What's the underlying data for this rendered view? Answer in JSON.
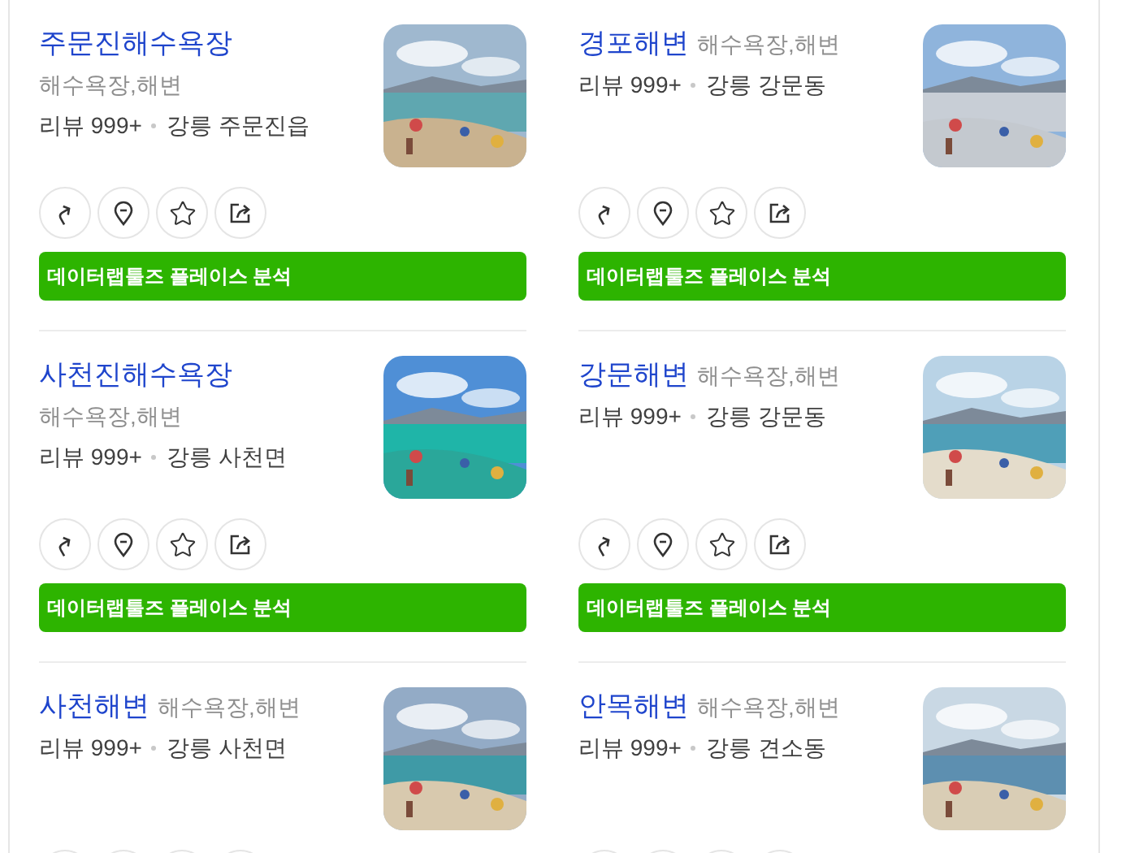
{
  "places": [
    {
      "name": "주문진해수욕장",
      "category": "해수욕장,해변",
      "reviews": "리뷰 999+",
      "location": "강릉 주문진읍",
      "analysis_button": "데이터랩툴즈 플레이스 분석"
    },
    {
      "name": "경포해변",
      "category": "해수욕장,해변",
      "reviews": "리뷰 999+",
      "location": "강릉 강문동",
      "analysis_button": "데이터랩툴즈 플레이스 분석"
    },
    {
      "name": "사천진해수욕장",
      "category": "해수욕장,해변",
      "reviews": "리뷰 999+",
      "location": "강릉 사천면",
      "analysis_button": "데이터랩툴즈 플레이스 분석"
    },
    {
      "name": "강문해변",
      "category": "해수욕장,해변",
      "reviews": "리뷰 999+",
      "location": "강릉 강문동",
      "analysis_button": "데이터랩툴즈 플레이스 분석"
    },
    {
      "name": "사천해변",
      "category": "해수욕장,해변",
      "reviews": "리뷰 999+",
      "location": "강릉 사천면"
    },
    {
      "name": "안목해변",
      "category": "해수욕장,해변",
      "reviews": "리뷰 999+",
      "location": "강릉 견소동"
    }
  ]
}
